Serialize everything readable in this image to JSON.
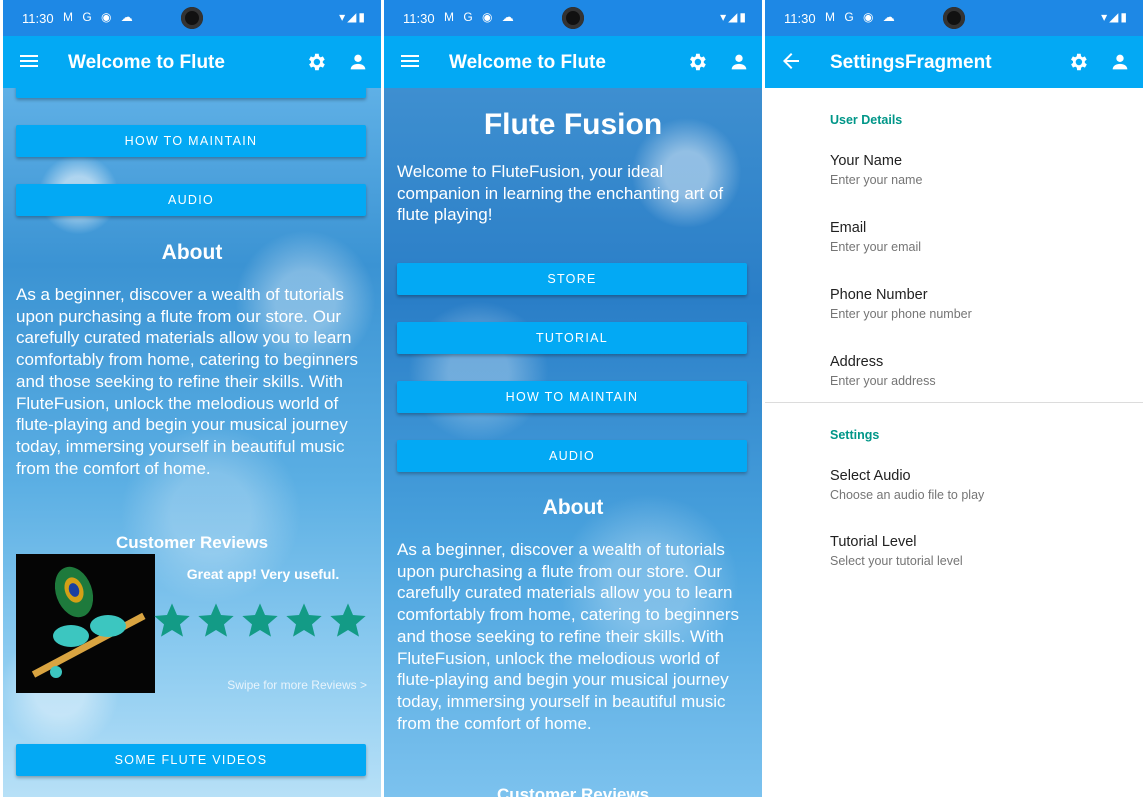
{
  "status_bar": {
    "time": "11:30",
    "icons_left": "M G ◉ ☁",
    "icons_right": "▾◢▮"
  },
  "screen1": {
    "app_title": "Welcome to Flute",
    "buttons": {
      "how_to_maintain": "HOW TO MAINTAIN",
      "audio": "AUDIO",
      "some_flute_videos": "SOME FLUTE VIDEOS"
    },
    "about_heading": "About",
    "about_text": "As a beginner, discover a wealth of tutorials upon purchasing a flute from our store. Our carefully curated materials allow you to learn comfortably from home, catering to beginners and those seeking to refine their skills. With FluteFusion, unlock the melodious world of flute-playing and begin your musical journey today, immersing yourself in beautiful music from the comfort of home.",
    "reviews_heading": "Customer Reviews",
    "review_text": "Great app! Very useful.",
    "rating": 5,
    "rating_max": 5,
    "swipe_hint": "Swipe for more Reviews >"
  },
  "screen2": {
    "app_title": "Welcome to Flute",
    "main_title": "Flute Fusion",
    "intro": "Welcome to FluteFusion, your ideal companion in learning the enchanting art of flute playing!",
    "buttons": {
      "store": "STORE",
      "tutorial": "TUTORIAL",
      "how_to_maintain": "HOW TO MAINTAIN",
      "audio": "AUDIO"
    },
    "about_heading": "About",
    "about_text": "As a beginner, discover a wealth of tutorials upon purchasing a flute from our store. Our carefully curated materials allow you to learn comfortably from home, catering to beginners and those seeking to refine their skills. With FluteFusion, unlock the melodious world of flute-playing and begin your musical journey today, immersing yourself in beautiful music from the comfort of home.",
    "reviews_heading": "Customer Reviews"
  },
  "screen3": {
    "app_title": "SettingsFragment",
    "user_details": {
      "category": "User Details",
      "items": [
        {
          "title": "Your Name",
          "summary": "Enter your name"
        },
        {
          "title": "Email",
          "summary": "Enter your email"
        },
        {
          "title": "Phone Number",
          "summary": "Enter your phone number"
        },
        {
          "title": "Address",
          "summary": "Enter your address"
        }
      ]
    },
    "settings": {
      "category": "Settings",
      "items": [
        {
          "title": "Select Audio",
          "summary": "Choose an audio file to play"
        },
        {
          "title": "Tutorial Level",
          "summary": "Select your tutorial level"
        }
      ]
    }
  },
  "colors": {
    "app_bar": "#03a9f4",
    "status_bar": "#1e88e5",
    "button": "#03a9f4",
    "star": "#139b86",
    "category": "#009688"
  },
  "icons": [
    "menu-icon",
    "gear-icon",
    "person-icon",
    "back-arrow-icon",
    "star-icon"
  ]
}
